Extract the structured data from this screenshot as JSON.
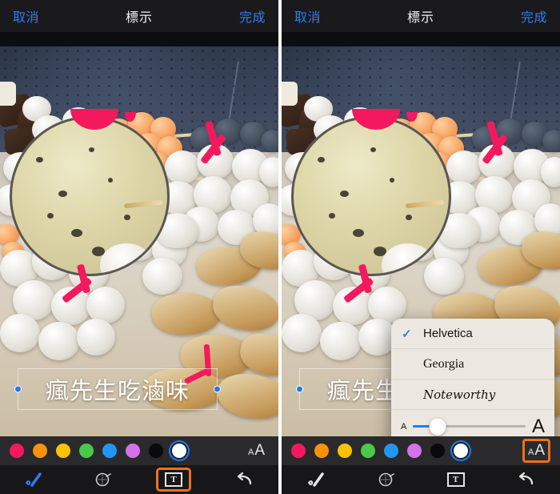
{
  "nav": {
    "cancel_label": "取消",
    "title": "標示",
    "done_label": "完成"
  },
  "photo": {
    "caption_full": "瘋先生吃滷味",
    "caption_partial": "瘋先生"
  },
  "font_popup": {
    "fonts": [
      {
        "name": "Helvetica",
        "selected": true,
        "check_glyph": "✓"
      },
      {
        "name": "Georgia",
        "selected": false,
        "check_glyph": ""
      },
      {
        "name": "Noteworthy",
        "selected": false,
        "check_glyph": ""
      }
    ],
    "size_slider": {
      "small_label": "A",
      "large_label": "A",
      "value_percent": 22
    },
    "alignment": {
      "options": [
        "align-left",
        "align-center",
        "align-justify",
        "align-right"
      ],
      "selected": "align-center"
    }
  },
  "colorbar": {
    "colors": [
      {
        "name": "pink",
        "hex": "#F4195E",
        "selected": false
      },
      {
        "name": "orange",
        "hex": "#F5940B",
        "selected": false
      },
      {
        "name": "yellow",
        "hex": "#FAC200",
        "selected": false
      },
      {
        "name": "green",
        "hex": "#4BC84B",
        "selected": false
      },
      {
        "name": "blue",
        "hex": "#2196F0",
        "selected": false
      },
      {
        "name": "violet",
        "hex": "#D472E8",
        "selected": false
      },
      {
        "name": "black",
        "hex": "#0A0A0A",
        "selected": false
      },
      {
        "name": "white",
        "hex": "#FFFFFF",
        "selected": true
      }
    ],
    "text_size_button": {
      "small": "A",
      "large": "A"
    }
  },
  "toolbar": {
    "tools": [
      {
        "name": "signature-pen",
        "highlighted": false
      },
      {
        "name": "magnifier",
        "highlighted": false
      },
      {
        "name": "text-box",
        "letter": "T",
        "highlighted": false
      },
      {
        "name": "undo",
        "highlighted": false
      }
    ],
    "left_panel_highlighted_tool": "text-box",
    "right_panel_highlighted_tool": "text-size"
  },
  "accent": {
    "highlight_hex": "#F07020",
    "ios_blue_hex": "#2F7CF6",
    "mark_pink_hex": "#F4195E"
  }
}
